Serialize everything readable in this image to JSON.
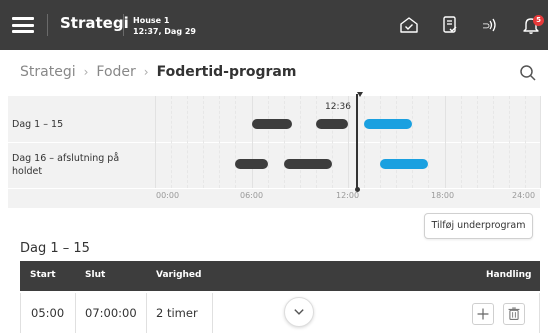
{
  "topbar": {
    "title": "Strategi",
    "house_name": "House 1",
    "house_time": "12:37, Dag 29",
    "notification_count": "5",
    "icons": [
      "menu-icon",
      "house-check-icon",
      "document-check-icon",
      "signal-icon",
      "bell-icon"
    ]
  },
  "breadcrumb": {
    "items": [
      "Strategi",
      "Foder",
      "Fodertid-program"
    ]
  },
  "timeline": {
    "rows": [
      {
        "label": "Dag 1 – 15",
        "bars": [
          {
            "start": "06:00",
            "end": "08:30",
            "color": "#3d3d3d"
          },
          {
            "start": "10:00",
            "end": "12:00",
            "color": "#3d3d3d"
          },
          {
            "start": "13:00",
            "end": "16:00",
            "color": "#1aa0e0"
          }
        ]
      },
      {
        "label": "Dag 16 – afslutning på holdet",
        "bars": [
          {
            "start": "05:00",
            "end": "07:00",
            "color": "#3d3d3d"
          },
          {
            "start": "08:00",
            "end": "11:00",
            "color": "#3d3d3d"
          },
          {
            "start": "14:00",
            "end": "17:00",
            "color": "#1aa0e0"
          }
        ]
      }
    ],
    "current_time": "12:36",
    "ticks": [
      "00:00",
      "06:00",
      "12:00",
      "18:00",
      "24:00"
    ]
  },
  "add_subprogram_label": "Tilføj underprogram",
  "section": {
    "title": "Dag 1 – 15",
    "columns": [
      "Start",
      "Slut",
      "Varighed",
      "Handling"
    ],
    "rows": [
      {
        "start": "05:00",
        "end": "07:00:00",
        "duration": "2 timer"
      }
    ]
  },
  "colors": {
    "header_bg": "#3d3d3d",
    "accent": "#1aa0e0",
    "badge": "#e63939",
    "panel_bg": "#f2f2f2"
  }
}
